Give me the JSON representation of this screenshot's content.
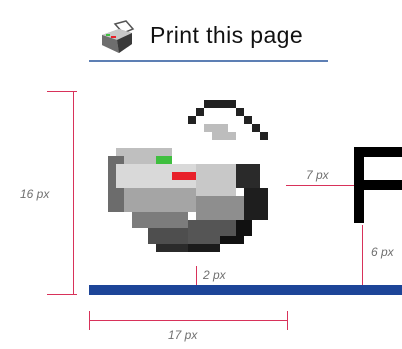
{
  "preview": {
    "label": "Print this page",
    "icon": "printer-icon"
  },
  "dimensions": {
    "height_label": "16 px",
    "width_label": "17 px",
    "gap_label": "7 px",
    "bottom_gap_label": "2 px",
    "text_offset_label": "6 px"
  },
  "colors": {
    "dimension_line": "#d8325a",
    "baseline_bar": "#1d4598",
    "underline": "#5d7fb4",
    "dimension_text": "#707070"
  }
}
